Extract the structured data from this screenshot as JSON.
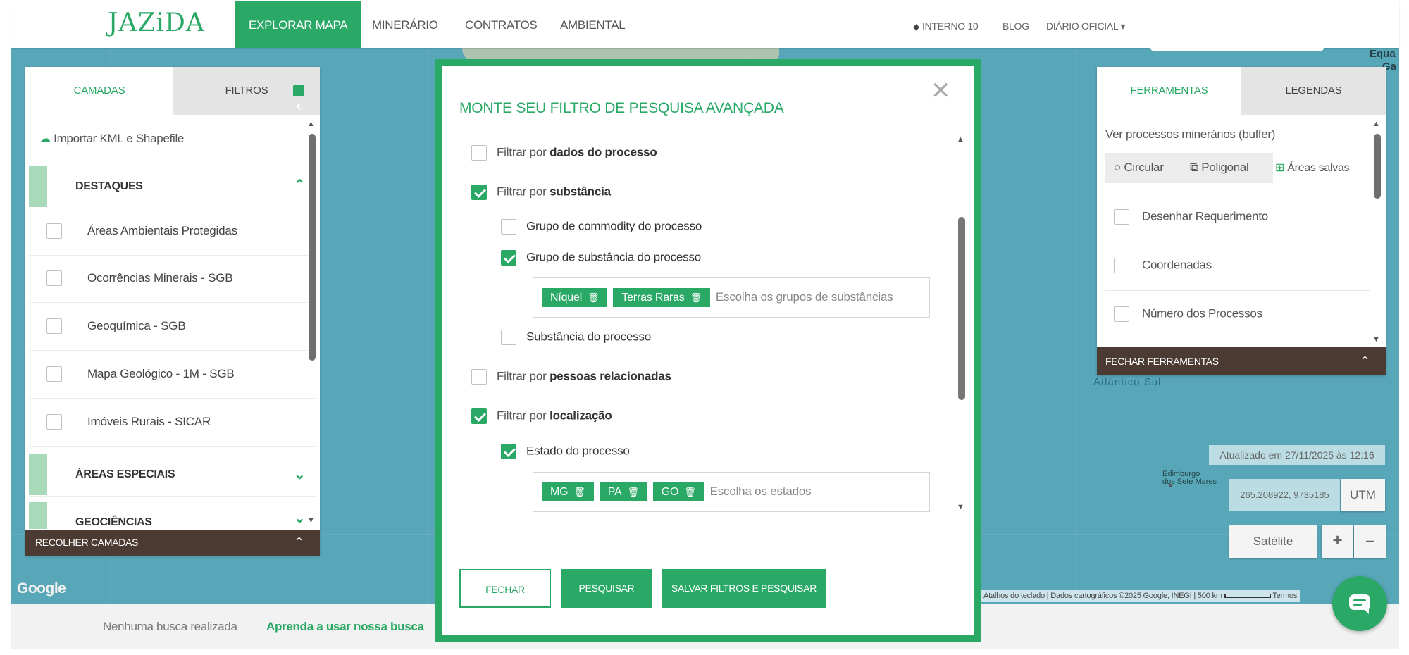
{
  "header": {
    "logo": "JAZiDA",
    "tabs": [
      {
        "label": "EXPLORAR MAPA"
      },
      {
        "label": "MINERÁRIO"
      },
      {
        "label": "CONTRATOS"
      },
      {
        "label": "AMBIENTAL"
      }
    ],
    "right": {
      "interno": "INTERNO 10",
      "blog": "BLOG",
      "diario": "DIÁRIO OFICIAL",
      "dropdown_caret": "▾"
    }
  },
  "left_panel": {
    "tabs": [
      "CAMADAS",
      "FILTROS"
    ],
    "import_label": "Importar KML e Shapefile",
    "sections": {
      "destaques": "DESTAQUES",
      "areas_especiais": "ÁREAS ESPECIAIS",
      "geociencias": "GEOCIÊNCIAS"
    },
    "layers": [
      {
        "label": "Áreas Ambientais Protegidas",
        "checked": false
      },
      {
        "label": "Ocorrências Minerais - SGB",
        "checked": false
      },
      {
        "label": "Geoquímica - SGB",
        "checked": false
      },
      {
        "label": "Mapa Geológico - 1M - SGB",
        "checked": false
      },
      {
        "label": "Imóveis Rurais - SICAR",
        "checked": false
      }
    ],
    "footer": "RECOLHER CAMADAS"
  },
  "modal": {
    "title": "MONTE SEU FILTRO DE PESQUISA AVANÇADA",
    "filter_prefix": "Filtrar por",
    "filters": [
      {
        "bold": "dados do processo",
        "checked": false
      },
      {
        "bold": "substância",
        "checked": true
      },
      {
        "bold": "pessoas relacionadas",
        "checked": false
      },
      {
        "bold": "localização",
        "checked": true
      }
    ],
    "substancia": {
      "grupo_commodity": {
        "label": "Grupo de commodity do processo",
        "checked": false
      },
      "grupo_substancia": {
        "label": "Grupo de substância do processo",
        "checked": true
      },
      "substancia": {
        "label": "Substância do processo",
        "checked": false
      },
      "tags": [
        "Níquel",
        "Terras Raras"
      ],
      "placeholder": "Escolha os grupos de substâncias"
    },
    "localizacao": {
      "estado": {
        "label": "Estado do processo",
        "checked": true
      },
      "tags": [
        "MG",
        "PA",
        "GO"
      ],
      "placeholder": "Escolha os estados"
    },
    "buttons": {
      "close": "FECHAR",
      "search": "PESQUISAR",
      "save_search": "SALVAR FILTROS E PESQUISAR"
    }
  },
  "right_panel": {
    "tabs": [
      "FERRAMENTAS",
      "LEGENDAS"
    ],
    "buffer_label": "Ver processos minerários (buffer)",
    "buffer_options": [
      "Circular",
      "Poligonal",
      "Áreas salvas"
    ],
    "tools": [
      {
        "label": "Desenhar Requerimento",
        "checked": false
      },
      {
        "label": "Coordenadas",
        "checked": false
      },
      {
        "label": "Número dos Processos",
        "checked": false
      }
    ],
    "footer": "FECHAR FERRAMENTAS"
  },
  "map": {
    "label_equa": "Equa",
    "label_ga": "Ga",
    "label_atlantico": "Atlântico Sul",
    "label_edimburgo": "Edimburgo\ndos Sete Mares",
    "updated": "Atualizado em 27/11/2025 às 12:16",
    "coords": "265.208922, 9735185",
    "coord_system": "UTM",
    "map_type": "Satélite",
    "zoom_in": "+",
    "zoom_out": "–",
    "google": "Google",
    "attribution": {
      "shortcuts": "Atalhos do teclado",
      "data": "Dados cartográficos ©2025 Google, INEGI",
      "scale": "500 km",
      "terms": "Termos"
    }
  },
  "bottom": {
    "no_search": "Nenhuma busca realizada",
    "learn": "Aprenda a usar nossa busca"
  },
  "colors": {
    "brand_green": "#2aa865",
    "map_water": "#58a7b9",
    "footer_brown": "#4b3b33"
  }
}
